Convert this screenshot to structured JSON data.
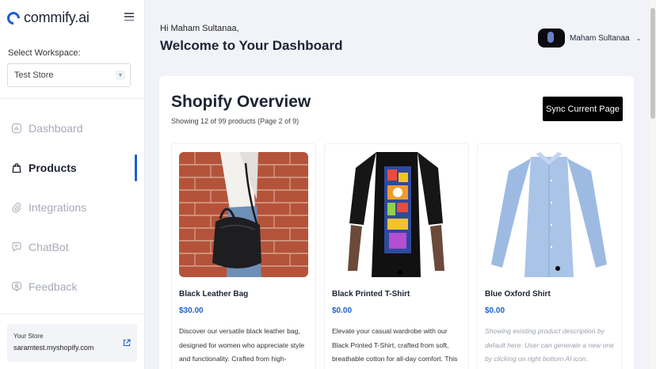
{
  "app": {
    "logo_text": "commify.ai"
  },
  "sidebar": {
    "workspace_label": "Select Workspace:",
    "workspace_value": "Test Store",
    "items": [
      {
        "label": "Dashboard",
        "icon": "chart-icon",
        "active": false
      },
      {
        "label": "Products",
        "icon": "bag-icon",
        "active": true
      },
      {
        "label": "Integrations",
        "icon": "paperclip-icon",
        "active": false
      },
      {
        "label": "ChatBot",
        "icon": "chat-icon",
        "active": false
      },
      {
        "label": "Feedback",
        "icon": "feedback-icon",
        "active": false
      }
    ],
    "store_label": "Your Store",
    "store_url": "saramtest.myshopify.com"
  },
  "header": {
    "greeting": "Hi Maham Sultanaa,",
    "title": "Welcome to Your Dashboard",
    "user_name": "Maham Sultanaa"
  },
  "overview": {
    "title": "Shopify Overview",
    "subtitle": "Showing 12 of 99 products (Page 2 of 9)",
    "sync_label": "Sync Current Page"
  },
  "products": [
    {
      "name": "Black Leather Bag",
      "price": "$30.00",
      "description": "Discover our versatile black leather bag, designed for women who appreciate style and functionality. Crafted from high-"
    },
    {
      "name": "Black Printed T-Shirt",
      "price": "$0.00",
      "description": "Elevate your casual wardrobe with our Black Printed T-Shirt, crafted from soft, breathable cotton for all-day comfort. This"
    },
    {
      "name": "Blue Oxford Shirt",
      "price": "$0.00",
      "description": "Showing existing product description by default here. User can generate a new one by clicking on right bottom AI icon."
    }
  ],
  "colors": {
    "accent": "#1a5fd0",
    "button_bg": "#000000",
    "page_bg": "#f1f3f8"
  }
}
